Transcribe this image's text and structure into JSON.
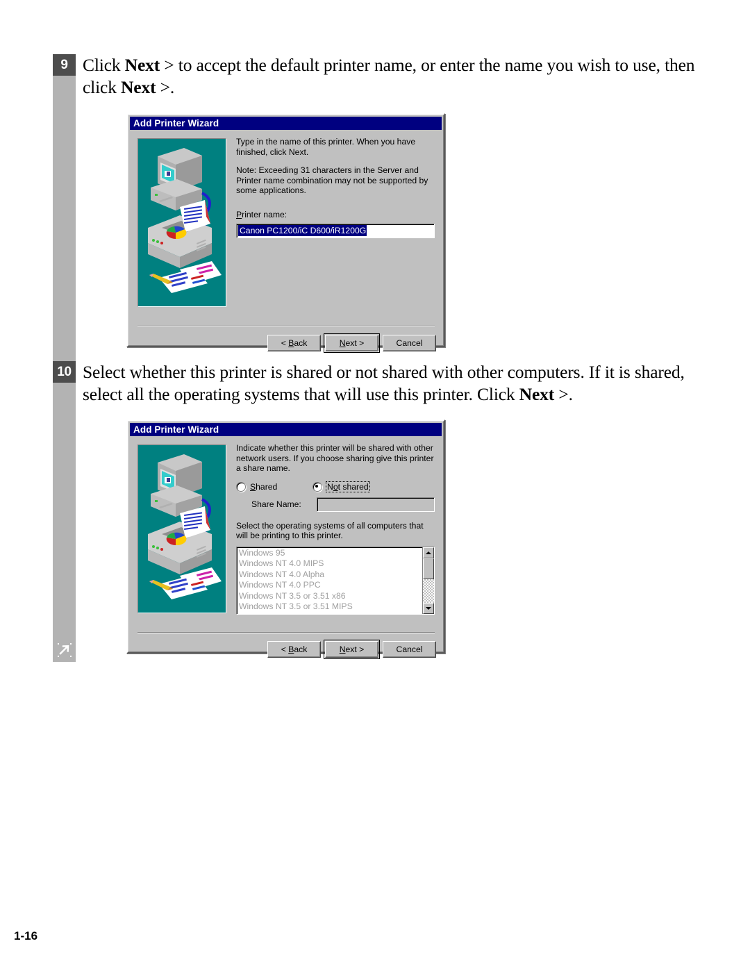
{
  "page": {
    "number": "1-16"
  },
  "steps": [
    {
      "num": "9",
      "text_parts": [
        {
          "t": "Click ",
          "b": false
        },
        {
          "t": "Next",
          "b": true
        },
        {
          "t": " > to accept the default printer name, or enter the name you wish to use, then click ",
          "b": false
        },
        {
          "t": "Next",
          "b": true
        },
        {
          "t": " >.",
          "b": false
        }
      ],
      "plain": "Click Next > to accept the default printer name, or enter the name you wish to use, then click Next >."
    },
    {
      "num": "10",
      "text_parts": [
        {
          "t": "Select whether this printer is shared or not shared with other computers. If it is shared, select all the operating systems that will use this printer. Click ",
          "b": false
        },
        {
          "t": "Next",
          "b": true
        },
        {
          "t": " >.",
          "b": false
        }
      ],
      "plain": "Select whether this printer is shared or not shared with other computers. If it is shared, select all the operating systems that will use this printer. Click Next >."
    }
  ],
  "dialog1": {
    "title": "Add Printer Wizard",
    "paragraph1": "Type in the name of this printer.  When you have finished, click Next.",
    "paragraph2": "Note:  Exceeding 31 characters in the Server and Printer name combination may not be supported by some applications.",
    "printer_name_label": "Printer name:",
    "printer_name_value": "Canon PC1200/iC D600/iR1200G",
    "buttons": {
      "back": "< Back",
      "next": "Next >",
      "cancel": "Cancel"
    }
  },
  "dialog2": {
    "title": "Add Printer Wizard",
    "paragraph1": "Indicate whether this printer will be shared with other network users.  If you choose sharing give this printer a share name.",
    "radio_shared": "Shared",
    "radio_not_shared": "Not shared",
    "radio_selected": "Not shared",
    "share_name_label": "Share Name:",
    "share_name_value": "",
    "paragraph2": "Select the operating systems of all computers that will be printing to this printer.",
    "os_list": [
      "Windows 95",
      "Windows NT 4.0 MIPS",
      "Windows NT 4.0 Alpha",
      "Windows NT 4.0 PPC",
      "Windows NT 3.5 or 3.51 x86",
      "Windows NT 3.5 or 3.51 MIPS"
    ],
    "buttons": {
      "back": "< Back",
      "next": "Next >",
      "cancel": "Cancel"
    }
  },
  "colors": {
    "titlebar": "#000080",
    "dialog_face": "#c0c0c0",
    "graphic_background": "#008080",
    "selection": "#000080",
    "rail": "#b3b3b3",
    "step_badge": "#4d4d4d"
  },
  "icons": {
    "rail_marker": "arrow-up-right-icon",
    "scroll_up": "scroll-up-arrow-icon",
    "scroll_down": "scroll-down-arrow-icon",
    "graphic": "computer-printer-documents-illustration"
  }
}
